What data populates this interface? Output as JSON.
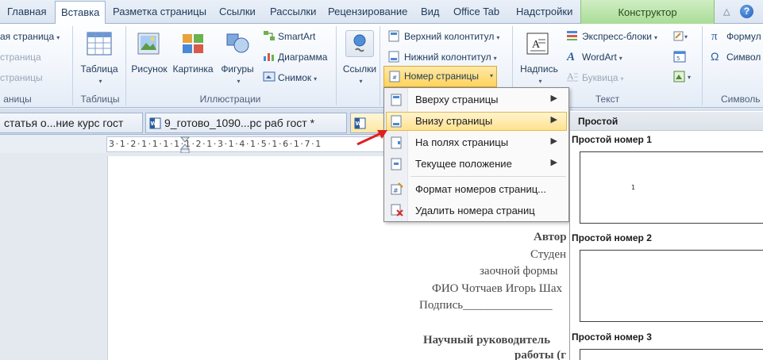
{
  "ribbon_tabs": [
    {
      "label": "Главная"
    },
    {
      "label": "Вставка"
    },
    {
      "label": "Разметка страницы"
    },
    {
      "label": "Ссылки"
    },
    {
      "label": "Рассылки"
    },
    {
      "label": "Рецензирование"
    },
    {
      "label": "Вид"
    },
    {
      "label": "Office Tab"
    },
    {
      "label": "Надстройки"
    }
  ],
  "context_tab": "Конструктор",
  "ribbon": {
    "pages_group": {
      "items": [
        "ая страница",
        "страница",
        "страницы"
      ],
      "label": "аницы"
    },
    "tables_group": {
      "table_label": "Таблица",
      "label": "Таблицы"
    },
    "illustrations_group": {
      "picture": "Рисунок",
      "clipart": "Картинка",
      "shapes": "Фигуры",
      "smartart": "SmartArt",
      "chart": "Диаграмма",
      "screenshot": "Снимок",
      "label": "Иллюстрации"
    },
    "links_group": {
      "links": "Ссылки"
    },
    "header_footer_group": {
      "header": "Верхний колонтитул",
      "footer": "Нижний колонтитул",
      "page_number": "Номер страницы"
    },
    "text_group": {
      "textbox": "Надпись",
      "quickparts": "Экспресс-блоки",
      "wordart": "WordArt",
      "dropcap": "Буквица",
      "label": "Текст"
    },
    "symbols_group": {
      "formula": "Формул",
      "symbol": "Символ",
      "label": "Символь"
    }
  },
  "doc_tabs": [
    {
      "title": "статья о...ние курс гост"
    },
    {
      "title": "9_готово_1090...рс раб гост *"
    }
  ],
  "ruler_text": "3·1·2·1·1·1·1·1·2·1·3·1·4·1·5·1·6·1·7·1",
  "document_lines": [
    "Автор",
    "Студен",
    "заочной формы",
    "ФИО Чотчаев Игорь Шах",
    "Подпись_______________",
    "Научный руководитель",
    "работы (г"
  ],
  "page_number_menu": [
    {
      "label": "Вверху страницы",
      "submenu": true
    },
    {
      "label": "Внизу страницы",
      "submenu": true,
      "highlighted": true
    },
    {
      "label": "На полях страницы",
      "submenu": true
    },
    {
      "label": "Текущее положение",
      "submenu": true
    },
    {
      "label": "Формат номеров страниц...",
      "submenu": false
    },
    {
      "label": "Удалить номера страниц",
      "submenu": false
    }
  ],
  "gallery": {
    "header": "Простой",
    "items": [
      {
        "title": "Простой номер 1",
        "sample": "1"
      },
      {
        "title": "Простой номер 2"
      },
      {
        "title": "Простой номер 3"
      }
    ]
  },
  "colors": {
    "accent_highlight": "#ffe28f",
    "arrow": "#e02020",
    "context_tab": "#a9dc97"
  }
}
